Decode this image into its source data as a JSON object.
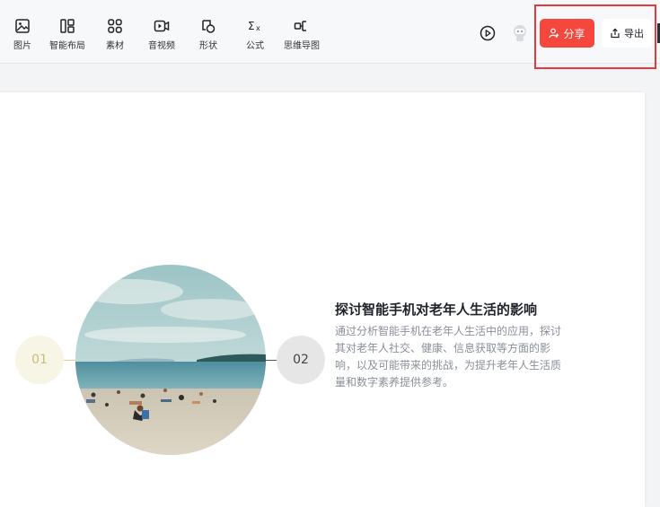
{
  "toolbar": {
    "tools": [
      {
        "label": "图片",
        "icon": "image-icon"
      },
      {
        "label": "智能布局",
        "icon": "smart-layout-icon"
      },
      {
        "label": "素材",
        "icon": "materials-icon"
      },
      {
        "label": "音视频",
        "icon": "video-icon"
      },
      {
        "label": "形状",
        "icon": "shape-icon"
      },
      {
        "label": "公式",
        "icon": "formula-icon"
      },
      {
        "label": "思维导图",
        "icon": "mind-map-icon"
      }
    ],
    "share_label": "分享",
    "export_label": "导出"
  },
  "slide": {
    "number_1": "01",
    "number_2": "02",
    "heading": "探讨智能手机对老年人生活的影响",
    "body_line_1": "通过分析智能手机在老年人生活中的应用，探讨",
    "body_line_2": "其对老年人社交、健康、信息获取等方面的影",
    "body_line_3": "响，以及可能带来的挑战，为提升老年人生活质",
    "body_line_4": "量和数字素养提供参考。"
  },
  "colors": {
    "accent_red": "#f4483f",
    "highlight_border": "#e8383d",
    "number_1_bg": "#f6f5e6",
    "number_2_bg": "#e6e6e6"
  }
}
